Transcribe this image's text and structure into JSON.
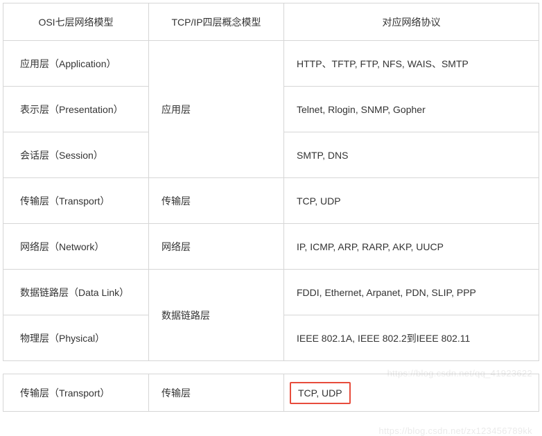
{
  "headers": {
    "osi": "OSI七层网络模型",
    "tcpip": "TCP/IP四层概念模型",
    "proto": "对应网络协议"
  },
  "rows": [
    {
      "osi": "应用层（Application）",
      "proto": "HTTP、TFTP, FTP, NFS, WAIS、SMTP"
    },
    {
      "osi": "表示层（Presentation）",
      "proto": "Telnet, Rlogin, SNMP, Gopher"
    },
    {
      "osi": "会话层（Session）",
      "proto": "SMTP, DNS"
    },
    {
      "osi": "传输层（Transport）",
      "proto": "TCP, UDP"
    },
    {
      "osi": "网络层（Network）",
      "proto": "IP, ICMP, ARP, RARP, AKP, UUCP"
    },
    {
      "osi": "数据链路层（Data Link）",
      "proto": "FDDI, Ethernet, Arpanet, PDN, SLIP, PPP"
    },
    {
      "osi": "物理层（Physical）",
      "proto": "IEEE 802.1A, IEEE 802.2到IEEE 802.11"
    }
  ],
  "tcpip_groups": [
    {
      "label": "应用层",
      "span": 3
    },
    {
      "label": "传输层",
      "span": 1
    },
    {
      "label": "网络层",
      "span": 1
    },
    {
      "label": "数据链路层",
      "span": 2
    }
  ],
  "snippet": {
    "osi": "传输层（Transport）",
    "tcpip": "传输层",
    "proto": "TCP, UDP"
  },
  "watermarks": {
    "w1": "https://blog.csdn.net/qq_41923622",
    "w2": "https://blog.csdn.net/zx123456789kk"
  }
}
